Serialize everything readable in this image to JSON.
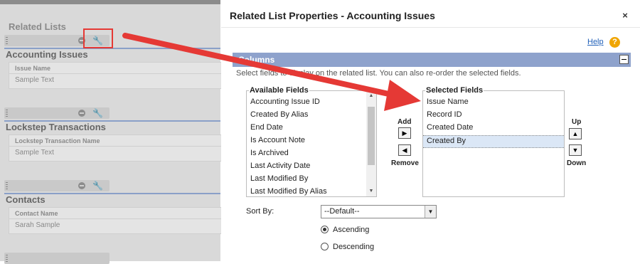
{
  "background": {
    "related_lists_title": "Related Lists",
    "sections": [
      {
        "title": "Accounting Issues",
        "column": "Issue Name",
        "value": "Sample Text"
      },
      {
        "title": "Lockstep Transactions",
        "column": "Lockstep Transaction Name",
        "value": "Sample Text"
      },
      {
        "title": "Contacts",
        "column": "Contact Name",
        "value": "Sarah Sample"
      }
    ]
  },
  "modal": {
    "title": "Related List Properties - Accounting Issues",
    "close_glyph": "×",
    "help_label": "Help",
    "help_glyph": "?",
    "columns_label": "Columns",
    "instructions": "Select fields to display on the related list. You can also re-order the selected fields.",
    "available": {
      "legend": "Available Fields",
      "items": [
        "Accounting Issue ID",
        "Created By Alias",
        "End Date",
        "Is Account Note",
        "Is Archived",
        "Last Activity Date",
        "Last Modified By",
        "Last Modified By Alias"
      ]
    },
    "selected": {
      "legend": "Selected Fields",
      "items": [
        "Issue Name",
        "Record ID",
        "Created Date",
        "Created By"
      ],
      "highlighted": "Created By"
    },
    "add_label": "Add",
    "remove_label": "Remove",
    "up_label": "Up",
    "down_label": "Down",
    "sort_by_label": "Sort By:",
    "sort_by_value": "--Default--",
    "ascending_label": "Ascending",
    "descending_label": "Descending",
    "sort_order": "Ascending"
  },
  "colors": {
    "annotation_red": "#e53935",
    "section_bar": "#8ea2cc",
    "link_blue": "#1f5fb8"
  }
}
